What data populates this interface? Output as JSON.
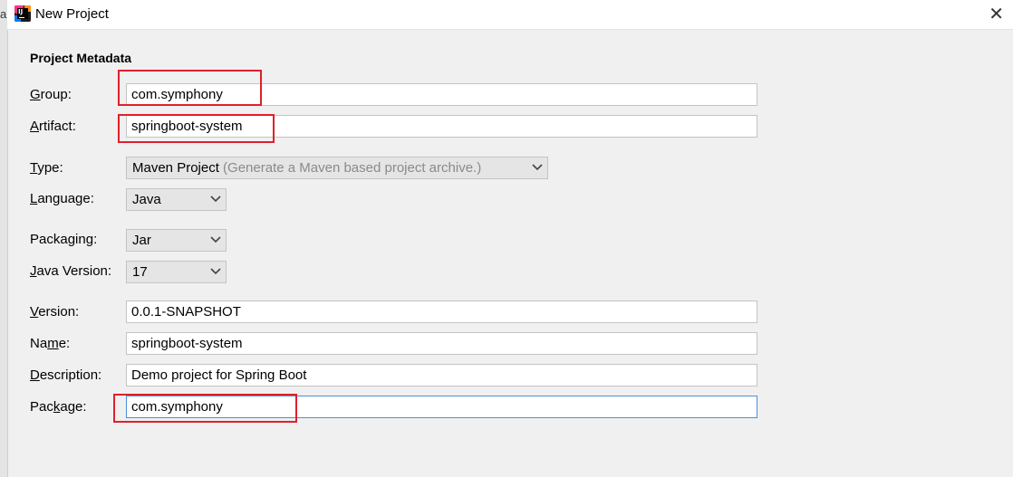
{
  "window": {
    "title": "New Project",
    "close_glyph": "✕",
    "left_fragment": "a"
  },
  "section": {
    "title": "Project Metadata"
  },
  "fields": {
    "group": {
      "label_mnemonic": "G",
      "label_rest": "roup:",
      "value": "com.symphony"
    },
    "artifact": {
      "label_mnemonic": "A",
      "label_rest": "rtifact:",
      "value": "springboot-system"
    },
    "type": {
      "label_mnemonic": "T",
      "label_rest": "ype:",
      "value": "Maven Project",
      "hint": "(Generate a Maven based project archive.)"
    },
    "language": {
      "label_mnemonic": "L",
      "label_rest": "anguage:",
      "value": "Java"
    },
    "packaging": {
      "label_pre": "Packa",
      "label_mnemonic": "g",
      "label_rest": "ing:",
      "value": "Jar"
    },
    "java_version": {
      "label_mnemonic": "J",
      "label_rest": "ava Version:",
      "value": "17"
    },
    "version": {
      "label_mnemonic": "V",
      "label_rest": "ersion:",
      "value": "0.0.1-SNAPSHOT"
    },
    "name": {
      "label_pre": "Na",
      "label_mnemonic": "m",
      "label_rest": "e:",
      "value": "springboot-system"
    },
    "description": {
      "label_mnemonic": "D",
      "label_rest": "escription:",
      "value": "Demo project for Spring Boot"
    },
    "package": {
      "label_pre": "Pac",
      "label_mnemonic": "k",
      "label_rest": "age:",
      "value": "com.symphony"
    }
  },
  "colors": {
    "highlight": "#e0202b",
    "focus_border": "#4a90d9",
    "background": "#f0f0f0"
  },
  "icons": {
    "app": "intellij-idea-icon",
    "close": "close-icon",
    "dropdown": "chevron-down-icon"
  }
}
